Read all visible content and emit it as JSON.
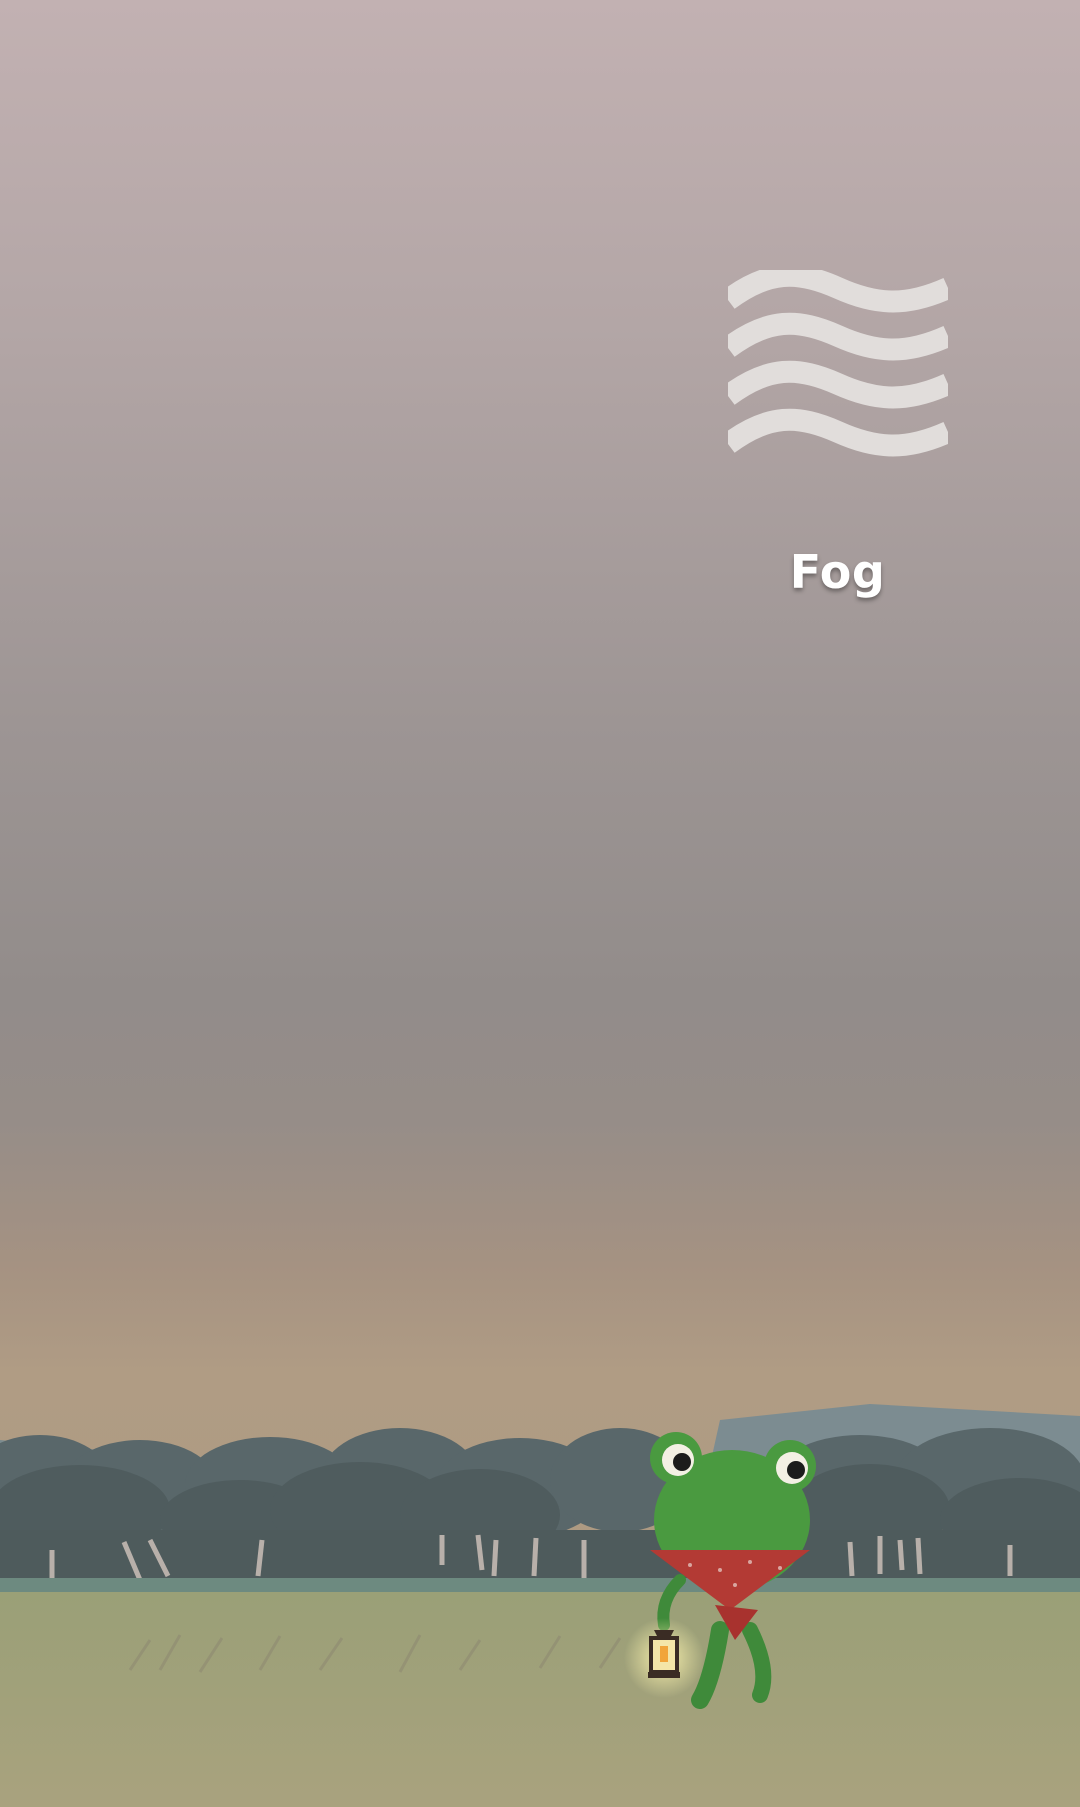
{
  "weather": {
    "condition_label": "Fog",
    "condition_icon": "fog-icon"
  },
  "scene": {
    "character": "frog-with-lantern",
    "background": "foggy-meadow-with-trees"
  },
  "colors": {
    "sky_top": "#c2b1b2",
    "sky_mid": "#928c8a",
    "horizon": "#b09c84",
    "icon": "#e0dcda",
    "label": "#ffffff"
  }
}
